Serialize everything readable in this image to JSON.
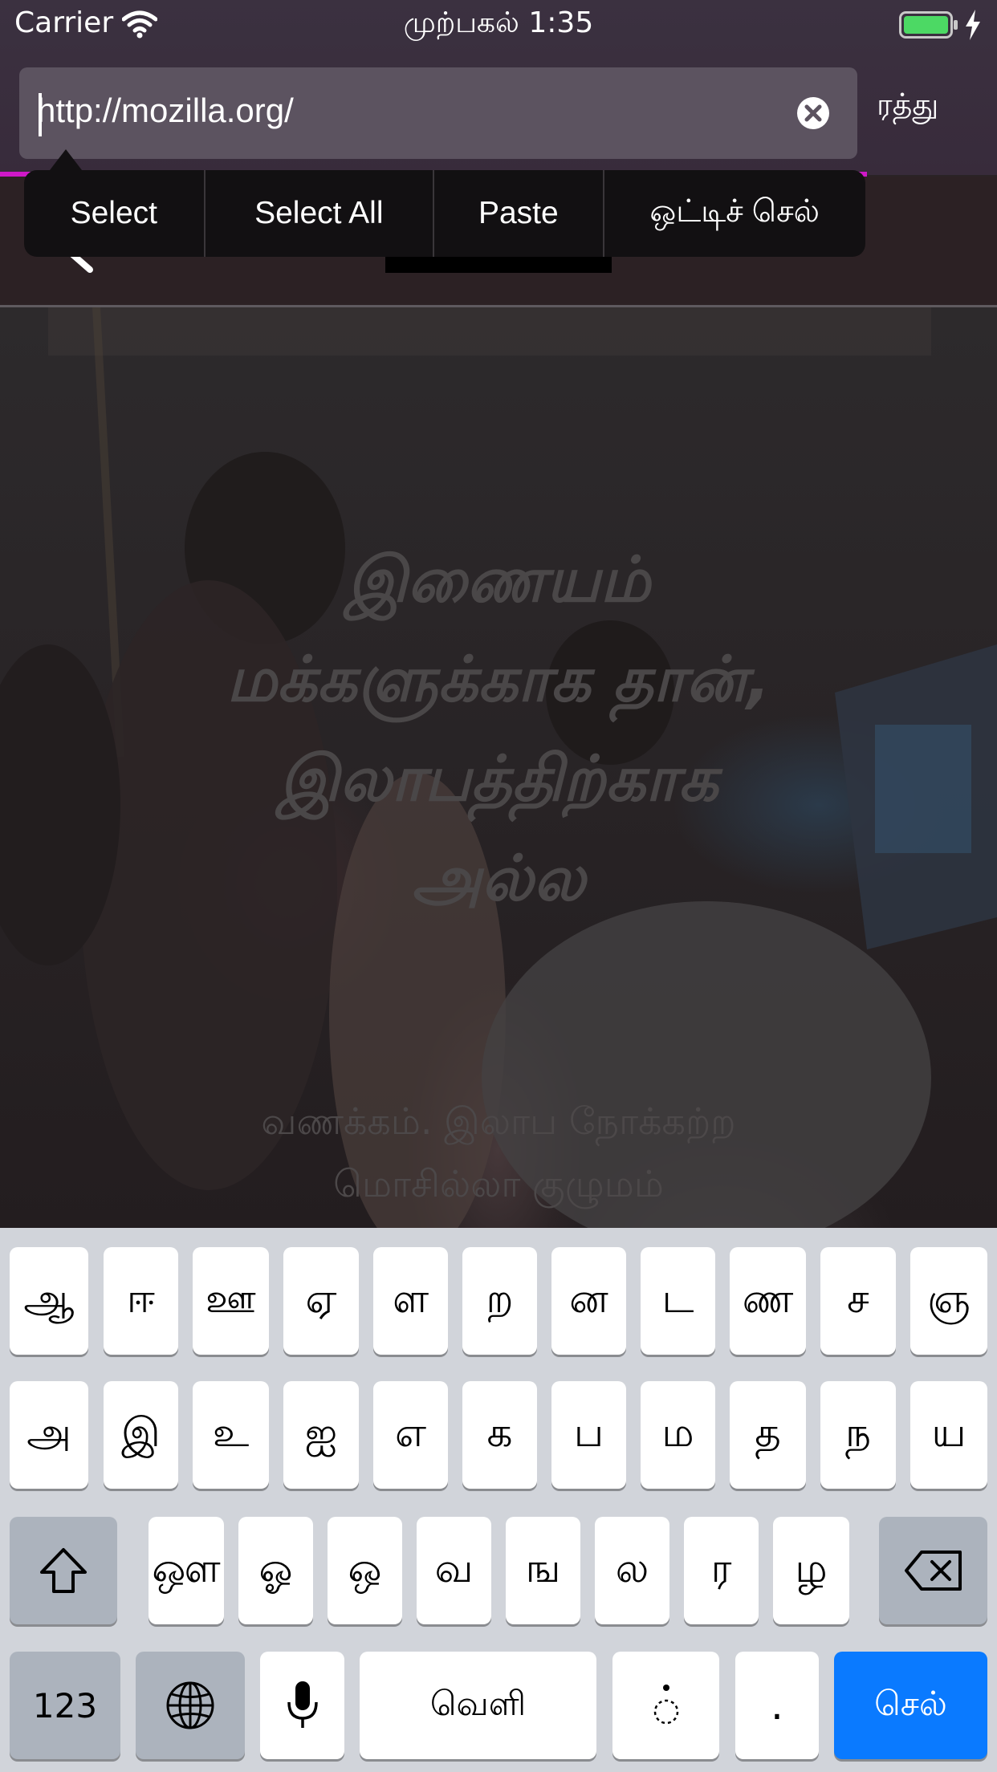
{
  "status_bar": {
    "carrier": "Carrier",
    "time": "முற்பகல் 1:35",
    "battery_color": "#4cd964"
  },
  "url_bar": {
    "url": "http://mozilla.org/",
    "cancel_label": "ரத்து"
  },
  "edit_menu": {
    "items": [
      "Select",
      "Select All",
      "Paste",
      "ஒட்டிச் செல்"
    ]
  },
  "page": {
    "headline": "இணையம்\nமக்களுக்காக தான்,\nஇலாபத்திற்காக\nஅல்ல",
    "subtext": "வணக்கம். இலாப நோக்கற்ற\nமொசில்லா குழுமம்"
  },
  "keyboard": {
    "row1": [
      "ஆ",
      "ஈ",
      "ஊ",
      "ஏ",
      "ள",
      "ற",
      "ன",
      "ட",
      "ண",
      "ச",
      "ஞ"
    ],
    "row2": [
      "அ",
      "இ",
      "உ",
      "ஐ",
      "எ",
      "க",
      "ப",
      "ம",
      "த",
      "ந",
      "ய"
    ],
    "row3": [
      "ஔ",
      "ஓ",
      "ஒ",
      "வ",
      "ங",
      "ல",
      "ர",
      "ழ"
    ],
    "numbers_label": "123",
    "space_label": "வெளி",
    "dot_label": "◌̇",
    "period_label": ".",
    "go_label": "செல்",
    "go_color": "#0a7aff"
  }
}
